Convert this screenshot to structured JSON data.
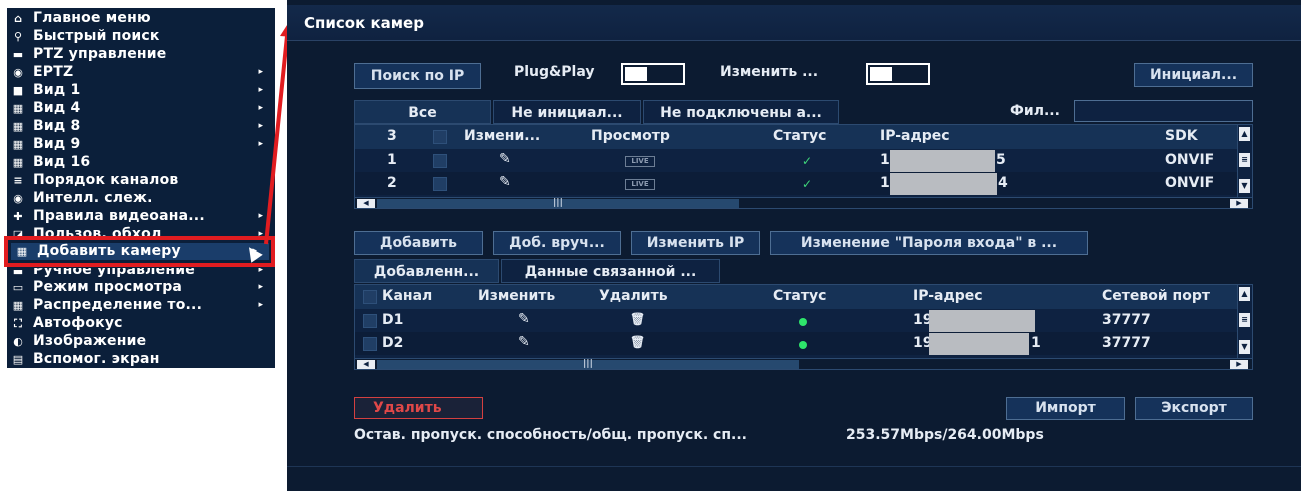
{
  "menu": {
    "items": [
      {
        "icon": "⌂",
        "label": "Главное меню",
        "arrow": ""
      },
      {
        "icon": "⚲",
        "label": "Быстрый поиск",
        "arrow": ""
      },
      {
        "icon": "▬",
        "label": "PTZ управление",
        "arrow": ""
      },
      {
        "icon": "◉",
        "label": "EPTZ",
        "arrow": "▸"
      },
      {
        "icon": "■",
        "label": "Вид 1",
        "arrow": "▸"
      },
      {
        "icon": "▦",
        "label": "Вид 4",
        "arrow": "▸"
      },
      {
        "icon": "▦",
        "label": "Вид 8",
        "arrow": "▸"
      },
      {
        "icon": "▦",
        "label": "Вид 9",
        "arrow": "▸"
      },
      {
        "icon": "▦",
        "label": "Вид 16",
        "arrow": ""
      },
      {
        "icon": "≡",
        "label": "Порядок каналов",
        "arrow": ""
      },
      {
        "icon": "◉",
        "label": "Интелл. слеж.",
        "arrow": ""
      },
      {
        "icon": "✚",
        "label": "Правила видеоана...",
        "arrow": "▸"
      },
      {
        "icon": "◪",
        "label": "Пользов. обход",
        "arrow": "▸"
      },
      {
        "icon": "▬",
        "label": "Ручное управление",
        "arrow": "▸"
      },
      {
        "icon": "▭",
        "label": "Режим просмотра",
        "arrow": "▸"
      },
      {
        "icon": "▦",
        "label": "Распределение то...",
        "arrow": "▸"
      },
      {
        "icon": "⛶",
        "label": "Автофокус",
        "arrow": ""
      },
      {
        "icon": "◐",
        "label": "Изображение",
        "arrow": ""
      },
      {
        "icon": "▤",
        "label": "Вспомог. экран",
        "arrow": ""
      }
    ],
    "highlighted": {
      "icon": "▦",
      "label": "Добавить камеру",
      "arrow": "▸"
    }
  },
  "panel": {
    "title": "Список камер",
    "search_ip_button": "Поиск по IP",
    "plug_play_label": "Plug&Play",
    "change_label": "Изменить ...",
    "initialize_button": "Инициал...",
    "filter_tabs": [
      "Все",
      "Не инициал...",
      "Не подключены а..."
    ],
    "filter_label": "Фил...",
    "found": {
      "headers": {
        "count": "3",
        "edit": "Измени...",
        "view": "Просмотр",
        "status": "Статус",
        "ip": "IP-адрес",
        "sdk": "SDK"
      },
      "rows": [
        {
          "num": "1",
          "live": "LIVE",
          "ip_start": "1",
          "ip_end": "5",
          "sdk": "ONVIF"
        },
        {
          "num": "2",
          "live": "LIVE",
          "ip_start": "1",
          "ip_end": "4",
          "sdk": "ONVIF"
        }
      ]
    },
    "action_buttons": [
      "Добавить",
      "Доб. вруч...",
      "Изменить IP",
      "Изменение \"Пароля входа\" в ..."
    ],
    "added_tabs": [
      "Добавленн...",
      "Данные связанной ..."
    ],
    "added": {
      "headers": {
        "channel": "Канал",
        "edit": "Изменить",
        "delete": "Удалить",
        "status": "Статус",
        "ip": "IP-адрес",
        "port": "Сетевой порт"
      },
      "rows": [
        {
          "channel": "D1",
          "ip_start": "19",
          "ip_end": "",
          "port": "37777"
        },
        {
          "channel": "D2",
          "ip_start": "19",
          "ip_end": "1",
          "port": "37777"
        }
      ]
    },
    "delete_button": "Удалить",
    "import_button": "Импорт",
    "export_button": "Экспорт",
    "bandwidth_label": "Остав. пропуск. способность/общ. пропуск. сп...",
    "bandwidth_value": "253.57Mbps/264.00Mbps"
  }
}
